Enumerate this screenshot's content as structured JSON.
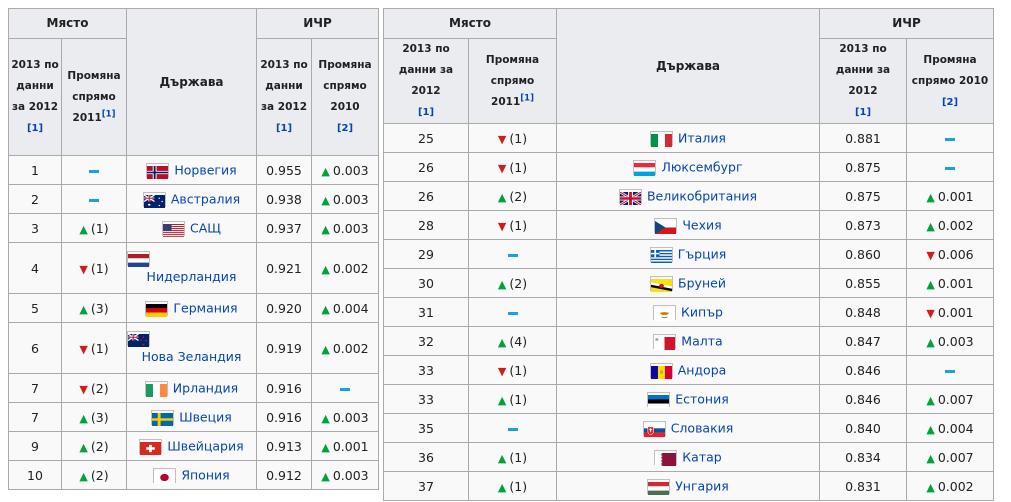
{
  "headers": {
    "place": "Място",
    "hdi": "ИЧР",
    "country": "Държава",
    "rank_sub_l1": "2013 по",
    "rank_sub_l2": "данни",
    "rank_sub_l3": "за 2012",
    "rank_sub_r": "2013 по данни за 2012",
    "change_sub_l1": "Промяна",
    "change_sub_l2": "спрямо",
    "change_sub_l3": "2011",
    "change_sub_r1": "Промяна спрямо",
    "change_sub_r2": "2011",
    "hdi_val_sub_l1": "2013 по",
    "hdi_val_sub_l2": "данни",
    "hdi_val_sub_l3": "за 2012",
    "hdi_val_sub_r": "2013 по данни за 2012",
    "hdi_chg_sub_l1": "Промяна",
    "hdi_chg_sub_l2": "спрямо",
    "hdi_chg_sub_l3": "2010",
    "hdi_chg_sub_r": "Промяна спрямо 2010",
    "ref1": "[1]",
    "ref2": "[2]"
  },
  "colors": {
    "up": "#00a23c",
    "down": "#d11c1c",
    "same": "#1ba0e6",
    "link": "#0645ad"
  },
  "left_rows": [
    {
      "rank": "1",
      "dir": "same",
      "chg": "",
      "country": "Норвегия",
      "flag": "norway-flag-icon",
      "hdi": "0.955",
      "hdir": "up",
      "hchg": "0.003"
    },
    {
      "rank": "2",
      "dir": "same",
      "chg": "",
      "country": "Австралия",
      "flag": "australia-flag-icon",
      "hdi": "0.938",
      "hdir": "up",
      "hchg": "0.003"
    },
    {
      "rank": "3",
      "dir": "up",
      "chg": "(1)",
      "country": "САЩ",
      "flag": "usa-flag-icon",
      "hdi": "0.937",
      "hdir": "up",
      "hchg": "0.003"
    },
    {
      "rank": "4",
      "dir": "down",
      "chg": "(1)",
      "country": "Нидерландия",
      "flag": "netherlands-flag-icon",
      "hdi": "0.921",
      "hdir": "up",
      "hchg": "0.002",
      "two": true
    },
    {
      "rank": "5",
      "dir": "up",
      "chg": "(3)",
      "country": "Германия",
      "flag": "germany-flag-icon",
      "hdi": "0.920",
      "hdir": "up",
      "hchg": "0.004"
    },
    {
      "rank": "6",
      "dir": "down",
      "chg": "(1)",
      "country": "Нова Зеландия",
      "flag": "new-zealand-flag-icon",
      "hdi": "0.919",
      "hdir": "up",
      "hchg": "0.002",
      "two": true
    },
    {
      "rank": "7",
      "dir": "down",
      "chg": "(2)",
      "country": "Ирландия",
      "flag": "ireland-flag-icon",
      "hdi": "0.916",
      "hdir": "same",
      "hchg": ""
    },
    {
      "rank": "7",
      "dir": "up",
      "chg": "(3)",
      "country": "Швеция",
      "flag": "sweden-flag-icon",
      "hdi": "0.916",
      "hdir": "up",
      "hchg": "0.003"
    },
    {
      "rank": "9",
      "dir": "up",
      "chg": "(2)",
      "country": "Швейцария",
      "flag": "switzerland-flag-icon",
      "hdi": "0.913",
      "hdir": "up",
      "hchg": "0.001"
    },
    {
      "rank": "10",
      "dir": "up",
      "chg": "(2)",
      "country": "Япония",
      "flag": "japan-flag-icon",
      "hdi": "0.912",
      "hdir": "up",
      "hchg": "0.003"
    }
  ],
  "right_rows": [
    {
      "rank": "25",
      "dir": "down",
      "chg": "(1)",
      "country": "Италия",
      "flag": "italy-flag-icon",
      "hdi": "0.881",
      "hdir": "same",
      "hchg": ""
    },
    {
      "rank": "26",
      "dir": "down",
      "chg": "(1)",
      "country": "Люксембург",
      "flag": "luxembourg-flag-icon",
      "hdi": "0.875",
      "hdir": "same",
      "hchg": ""
    },
    {
      "rank": "26",
      "dir": "up",
      "chg": "(2)",
      "country": "Великобритания",
      "flag": "uk-flag-icon",
      "hdi": "0.875",
      "hdir": "up",
      "hchg": "0.001"
    },
    {
      "rank": "28",
      "dir": "down",
      "chg": "(1)",
      "country": "Чехия",
      "flag": "czech-flag-icon",
      "hdi": "0.873",
      "hdir": "up",
      "hchg": "0.002"
    },
    {
      "rank": "29",
      "dir": "same",
      "chg": "",
      "country": "Гърция",
      "flag": "greece-flag-icon",
      "hdi": "0.860",
      "hdir": "down",
      "hchg": "0.006"
    },
    {
      "rank": "30",
      "dir": "up",
      "chg": "(2)",
      "country": "Бруней",
      "flag": "brunei-flag-icon",
      "hdi": "0.855",
      "hdir": "up",
      "hchg": "0.001"
    },
    {
      "rank": "31",
      "dir": "same",
      "chg": "",
      "country": "Кипър",
      "flag": "cyprus-flag-icon",
      "hdi": "0.848",
      "hdir": "down",
      "hchg": "0.001"
    },
    {
      "rank": "32",
      "dir": "up",
      "chg": "(4)",
      "country": "Малта",
      "flag": "malta-flag-icon",
      "hdi": "0.847",
      "hdir": "up",
      "hchg": "0.003"
    },
    {
      "rank": "33",
      "dir": "down",
      "chg": "(1)",
      "country": "Андора",
      "flag": "andorra-flag-icon",
      "hdi": "0.846",
      "hdir": "same",
      "hchg": ""
    },
    {
      "rank": "33",
      "dir": "up",
      "chg": "(1)",
      "country": "Естония",
      "flag": "estonia-flag-icon",
      "hdi": "0.846",
      "hdir": "up",
      "hchg": "0.007"
    },
    {
      "rank": "35",
      "dir": "same",
      "chg": "",
      "country": "Словакия",
      "flag": "slovakia-flag-icon",
      "hdi": "0.840",
      "hdir": "up",
      "hchg": "0.004"
    },
    {
      "rank": "36",
      "dir": "up",
      "chg": "(1)",
      "country": "Катар",
      "flag": "qatar-flag-icon",
      "hdi": "0.834",
      "hdir": "up",
      "hchg": "0.007"
    },
    {
      "rank": "37",
      "dir": "up",
      "chg": "(1)",
      "country": "Унгария",
      "flag": "hungary-flag-icon",
      "hdi": "0.831",
      "hdir": "up",
      "hchg": "0.002"
    }
  ]
}
